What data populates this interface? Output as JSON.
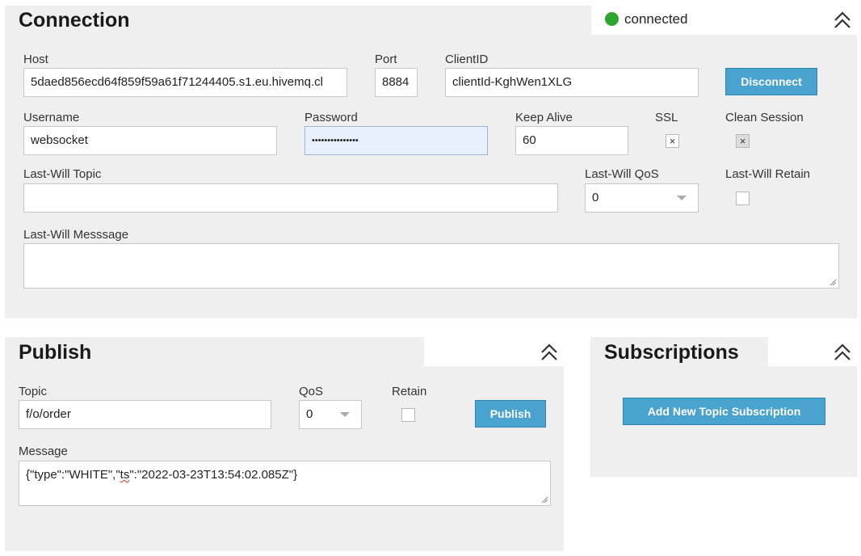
{
  "connection": {
    "title": "Connection",
    "status": "connected",
    "status_color": "#2ea52e",
    "host_label": "Host",
    "host_value": "5daed856ecd64f859f59a61f71244405.s1.eu.hivemq.cl",
    "port_label": "Port",
    "port_value": "8884",
    "clientid_label": "ClientID",
    "clientid_value": "clientId-KghWen1XLG",
    "disconnect_label": "Disconnect",
    "username_label": "Username",
    "username_value": "websocket",
    "password_label": "Password",
    "password_value": "•••••••••••••••",
    "keepalive_label": "Keep Alive",
    "keepalive_value": "60",
    "ssl_label": "SSL",
    "ssl_checked": "×",
    "clean_label": "Clean Session",
    "clean_checked": "×",
    "lw_topic_label": "Last-Will Topic",
    "lw_topic_value": "",
    "lw_qos_label": "Last-Will QoS",
    "lw_qos_value": "0",
    "lw_retain_label": "Last-Will Retain",
    "lw_message_label": "Last-Will Messsage",
    "lw_message_value": ""
  },
  "publish": {
    "title": "Publish",
    "topic_label": "Topic",
    "topic_value": "f/o/order",
    "qos_label": "QoS",
    "qos_value": "0",
    "retain_label": "Retain",
    "publish_label": "Publish",
    "message_label": "Message",
    "message_pre": "{\"type\":\"WHITE\",\"",
    "message_ts": "ts",
    "message_post": "\":\"2022-03-23T13:54:02.085Z\"}"
  },
  "subscriptions": {
    "title": "Subscriptions",
    "add_label": "Add New Topic Subscription"
  },
  "colors": {
    "accent": "#4aa3cf",
    "panel": "#efefef"
  },
  "icons": {
    "collapse": "chevron-double-up-icon",
    "status": "status-dot-icon",
    "dropdown": "caret-down-icon",
    "resize": "resize-handle-icon"
  }
}
